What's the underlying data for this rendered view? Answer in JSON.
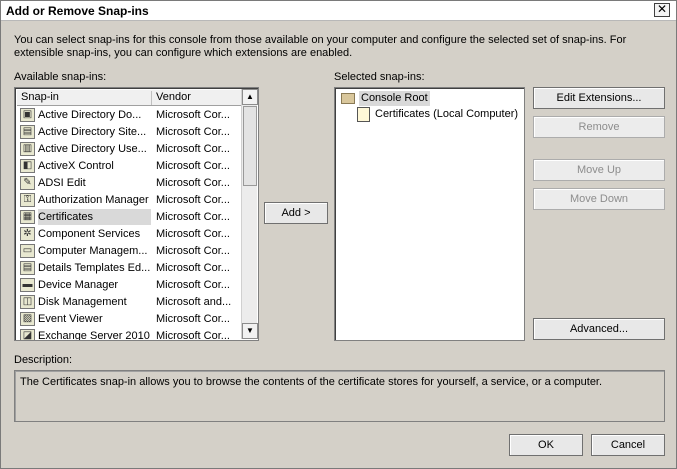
{
  "window": {
    "title": "Add or Remove Snap-ins",
    "close_glyph": "✕"
  },
  "intro_text": "You can select snap-ins for this console from those available on your computer and configure the selected set of snap-ins. For extensible snap-ins, you can configure which extensions are enabled.",
  "available": {
    "label": "Available snap-ins:",
    "columns": [
      "Snap-in",
      "Vendor"
    ],
    "items": [
      {
        "name": "Active Directory Do...",
        "vendor": "Microsoft Cor...",
        "icon": "ad-domains-icon"
      },
      {
        "name": "Active Directory Site...",
        "vendor": "Microsoft Cor...",
        "icon": "ad-sites-icon"
      },
      {
        "name": "Active Directory Use...",
        "vendor": "Microsoft Cor...",
        "icon": "ad-users-icon"
      },
      {
        "name": "ActiveX Control",
        "vendor": "Microsoft Cor...",
        "icon": "activex-icon"
      },
      {
        "name": "ADSI Edit",
        "vendor": "Microsoft Cor...",
        "icon": "adsi-edit-icon"
      },
      {
        "name": "Authorization Manager",
        "vendor": "Microsoft Cor...",
        "icon": "authorization-icon"
      },
      {
        "name": "Certificates",
        "vendor": "Microsoft Cor...",
        "icon": "certificates-icon",
        "selected": true
      },
      {
        "name": "Component Services",
        "vendor": "Microsoft Cor...",
        "icon": "component-services-icon"
      },
      {
        "name": "Computer Managem...",
        "vendor": "Microsoft Cor...",
        "icon": "computer-management-icon"
      },
      {
        "name": "Details Templates Ed...",
        "vendor": "Microsoft Cor...",
        "icon": "details-templates-icon"
      },
      {
        "name": "Device Manager",
        "vendor": "Microsoft Cor...",
        "icon": "device-manager-icon"
      },
      {
        "name": "Disk Management",
        "vendor": "Microsoft and...",
        "icon": "disk-management-icon"
      },
      {
        "name": "Event Viewer",
        "vendor": "Microsoft Cor...",
        "icon": "event-viewer-icon"
      },
      {
        "name": "Exchange Server 2010",
        "vendor": "Microsoft Cor...",
        "icon": "exchange-server-icon"
      }
    ]
  },
  "add_button": "Add >",
  "selected": {
    "label": "Selected snap-ins:",
    "root": "Console Root",
    "child": "Certificates (Local Computer)"
  },
  "buttons": {
    "edit_extensions": "Edit Extensions...",
    "remove": "Remove",
    "move_up": "Move Up",
    "move_down": "Move Down",
    "advanced": "Advanced...",
    "ok": "OK",
    "cancel": "Cancel"
  },
  "description": {
    "label": "Description:",
    "text": "The Certificates snap-in allows you to browse the contents of the certificate stores for yourself, a service, or a computer."
  }
}
